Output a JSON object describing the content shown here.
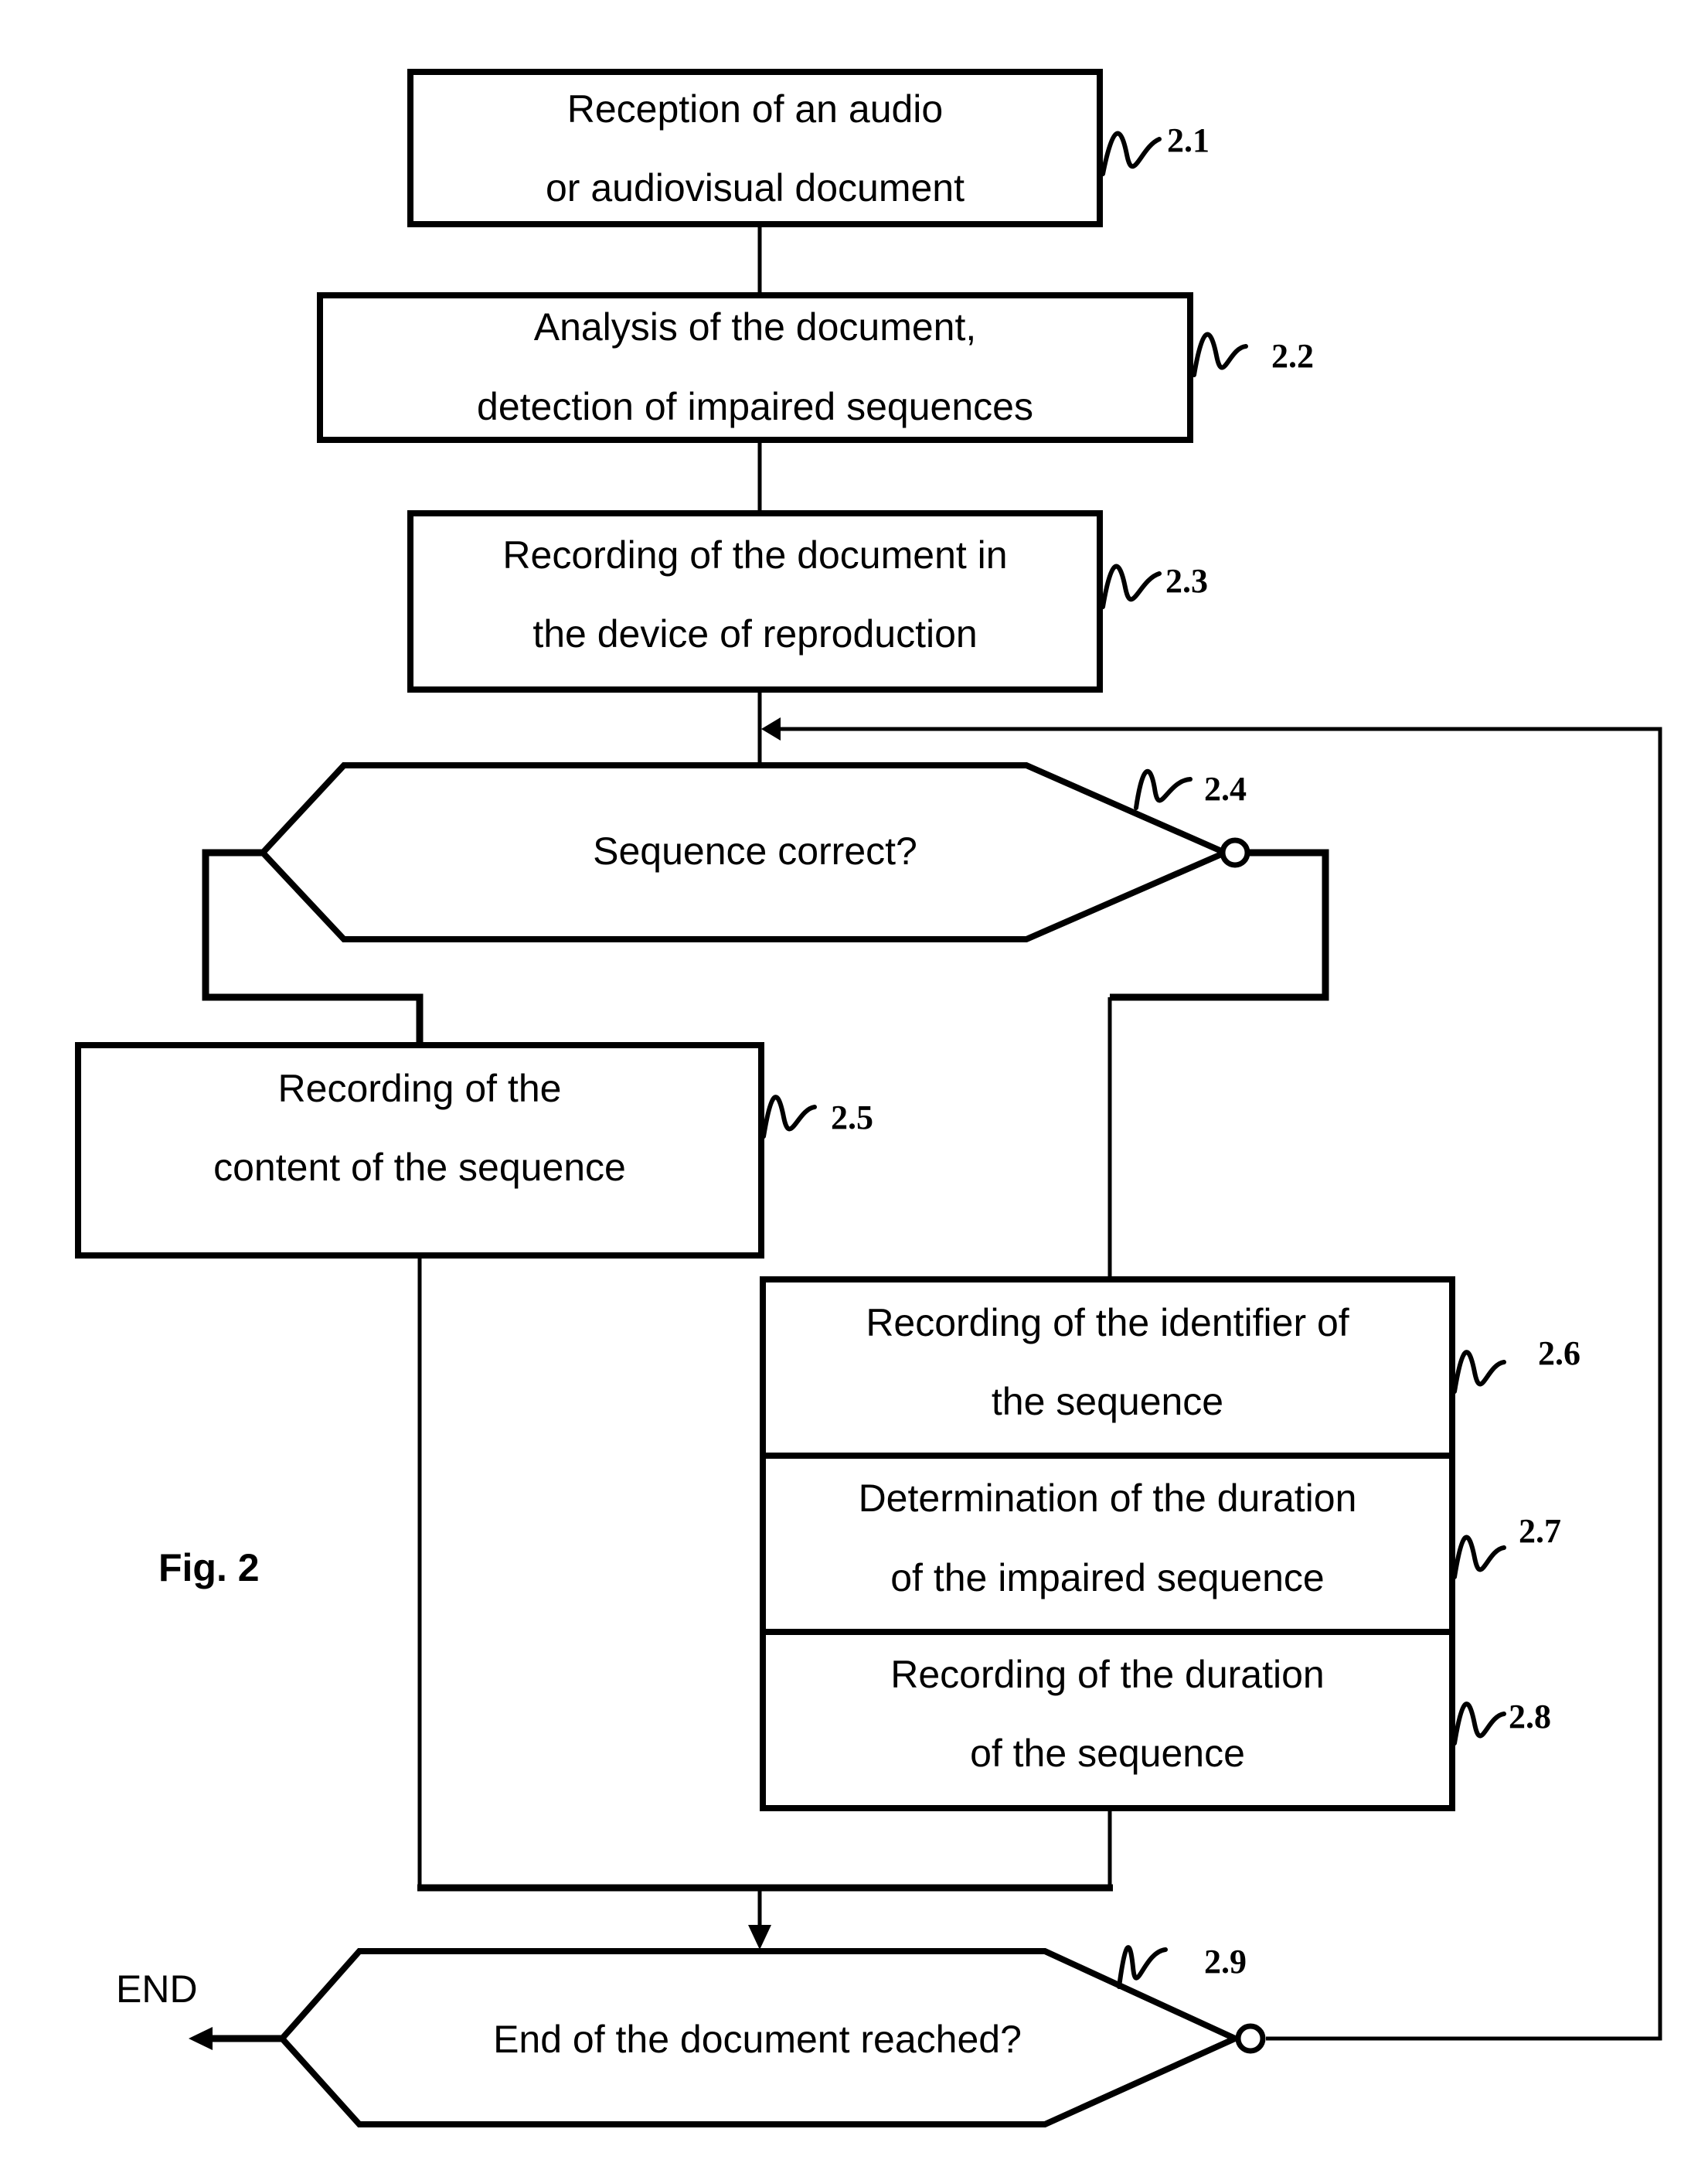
{
  "figure": {
    "label": "Fig. 2",
    "end_label": "END"
  },
  "steps": {
    "s2_1": {
      "ref": "2.1",
      "lines": [
        "Reception of an audio",
        "or audiovisual document"
      ]
    },
    "s2_2": {
      "ref": "2.2",
      "lines": [
        "Analysis of the document,",
        "detection of impaired sequences"
      ]
    },
    "s2_3": {
      "ref": "2.3",
      "lines": [
        "Recording of the document in",
        "the device of reproduction"
      ]
    },
    "s2_4": {
      "ref": "2.4",
      "lines": [
        "Sequence correct?"
      ]
    },
    "s2_5": {
      "ref": "2.5",
      "lines": [
        "Recording of the",
        "content of the sequence"
      ]
    },
    "s2_6": {
      "ref": "2.6",
      "lines": [
        "Recording of the identifier of",
        "the sequence"
      ]
    },
    "s2_7": {
      "ref": "2.7",
      "lines": [
        "Determination of the duration",
        "of the impaired sequence"
      ]
    },
    "s2_8": {
      "ref": "2.8",
      "lines": [
        "Recording of the duration",
        "of the sequence"
      ]
    },
    "s2_9": {
      "ref": "2.9",
      "lines": [
        "End of the document reached?"
      ]
    }
  }
}
